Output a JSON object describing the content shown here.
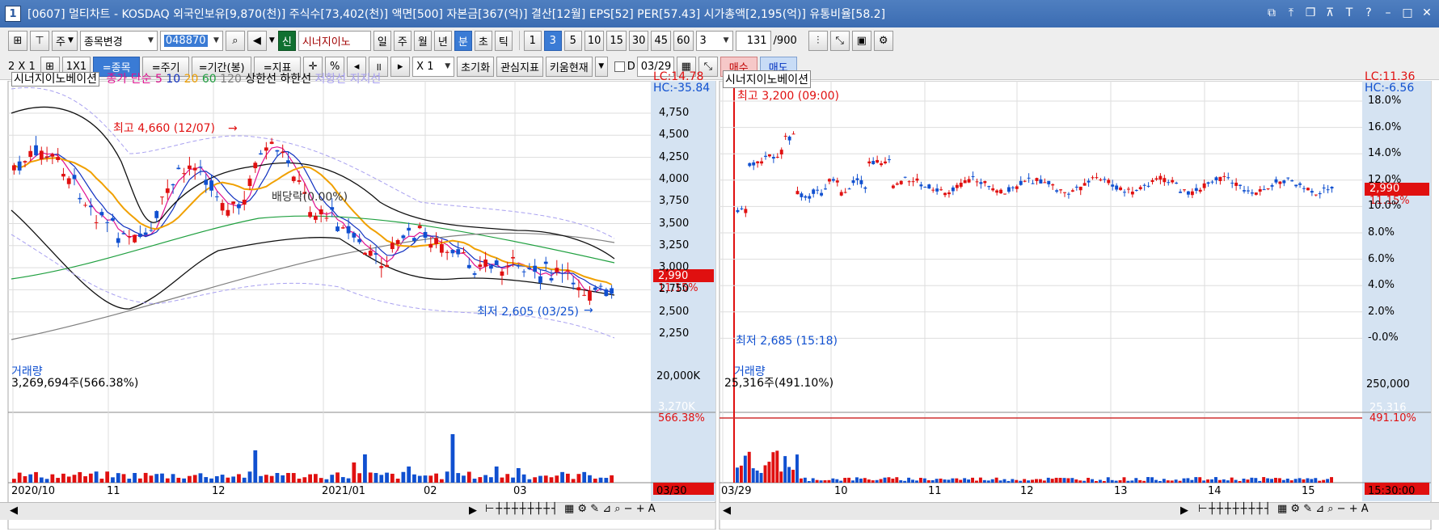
{
  "window": {
    "number": "1",
    "title": "[0607] 멀티차트 - KOSDAQ 외국인보유[9,870(천)] 주식수[73,402(천)] 액면[500] 자본금[367(억)] 결산[12월] EPS[52] PER[57.43] 시가총액[2,195(억)] 유통비율[58.2]"
  },
  "toolbar1": {
    "period_type": "주",
    "stock_change": "종목변경",
    "stock_code": "048870",
    "new_badge": "신",
    "stock_name": "시너지이노",
    "period_day": "일",
    "period_week": "주",
    "period_month": "월",
    "period_year": "년",
    "period_min": "분",
    "period_tick": "초",
    "period_tick2": "틱",
    "num_1": "1",
    "num_3": "3",
    "num_5": "5",
    "num_10": "10",
    "num_15": "15",
    "num_30": "30",
    "num_45": "45",
    "num_60": "60",
    "interval": "3",
    "count": "131",
    "count_max": "/900"
  },
  "toolbar2": {
    "layout": "2 X 1",
    "one_by_one": "1X1",
    "stock_btn": "=종목",
    "cycle_btn": "=주기",
    "period_btn": "=기간(봉)",
    "index_btn": "=지표",
    "percent": "%",
    "zoom": "X 1",
    "reset": "초기화",
    "fav_index": "관심지표",
    "kiwoom": "키움현재",
    "date_prefix": "D",
    "date": "03/29",
    "buy": "매수",
    "sell": "매도"
  },
  "left_chart": {
    "stock": "시너지이노베이션",
    "ma_label": "종가 단순",
    "ma5": "5",
    "ma10": "10",
    "ma20": "20",
    "ma60": "60",
    "ma120": "120",
    "upper": "상한선",
    "lower": "하한선",
    "resist": "저항선",
    "support": "지지선",
    "lc": "LC:14.78",
    "hc": "HC:-35.84",
    "high_label": "최고 4,660 (12/07)",
    "low_label": "최저 2,605 (03/25)",
    "dividend": "배당락(0.00%)",
    "price": "2,990",
    "price_pct": "11.15%",
    "volume_title": "거래량",
    "volume_value": "3,269,694주(566.38%)",
    "vol_axis": "20,000K",
    "vol_now": "3,270K",
    "vol_pct": "566.38%",
    "x_labels": [
      "2020/10",
      "11",
      "12",
      "2021/01",
      "02",
      "03"
    ],
    "x_end": "03/30",
    "y_labels": [
      "4,750",
      "4,500",
      "4,250",
      "4,000",
      "3,750",
      "3,500",
      "3,250",
      "3,000",
      "2,750",
      "2,500",
      "2,250"
    ]
  },
  "right_chart": {
    "stock": "시너지이노베이션",
    "lc": "LC:11.36",
    "hc": "HC:-6.56",
    "high_label": "최고 3,200 (09:00)",
    "low_label": "최저 2,685 (15:18)",
    "price": "2,990",
    "price_pct": "11.15%",
    "volume_title": "거래량",
    "volume_value": "25,316주(491.10%)",
    "vol_axis": "250,000",
    "vol_now": "25,316",
    "vol_pct": "491.10%",
    "x_labels": [
      "03/29",
      "10",
      "11",
      "12",
      "13",
      "14",
      "15"
    ],
    "x_end": "15:30:00",
    "y_labels": [
      "18.0%",
      "16.0%",
      "14.0%",
      "12.0%",
      "10.0%",
      "8.0%",
      "6.0%",
      "4.0%",
      "2.0%",
      "-0.0%"
    ]
  },
  "colors": {
    "up": "#e01010",
    "down": "#1050d0",
    "ma5": "#e01090",
    "ma10": "#1030c0",
    "ma20": "#f0a000",
    "ma60": "#20a040",
    "ma120": "#808080",
    "band": "#101010",
    "env": "#a8a0f0"
  }
}
